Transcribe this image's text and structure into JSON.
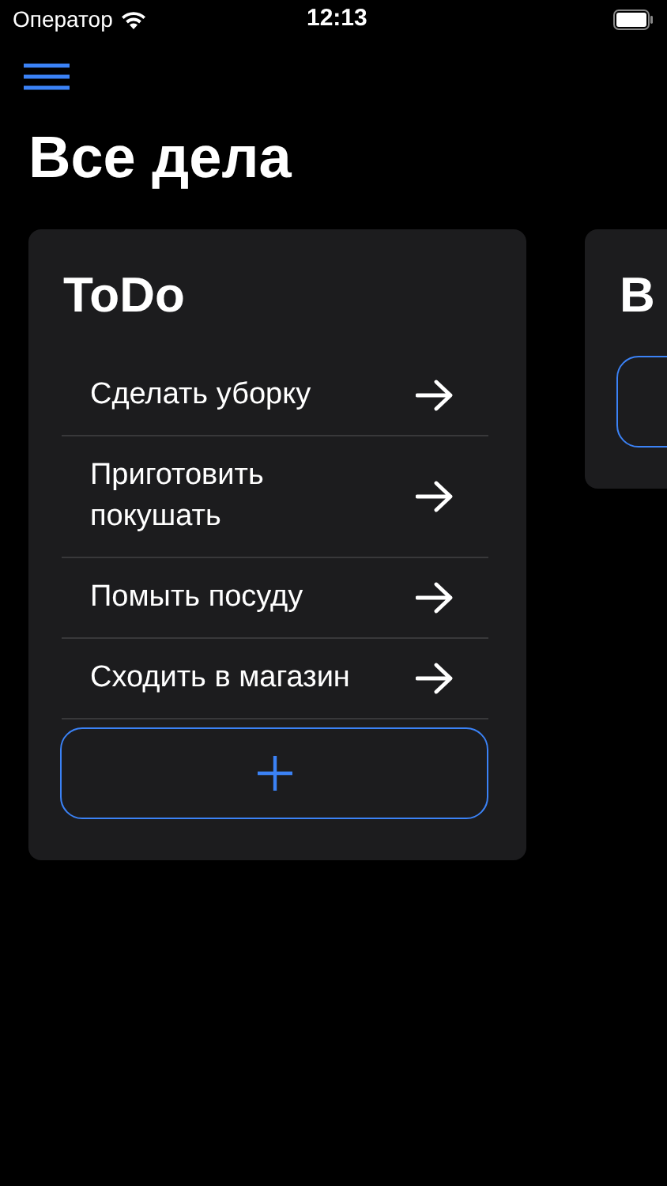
{
  "status_bar": {
    "carrier": "Оператор",
    "time": "12:13"
  },
  "title": "Все дела",
  "boards": [
    {
      "title": "ToDo",
      "tasks": [
        "Сделать уборку",
        "Приготовить покушать",
        "Помыть посуду",
        "Сходить в магазин"
      ]
    },
    {
      "title": "В"
    }
  ]
}
